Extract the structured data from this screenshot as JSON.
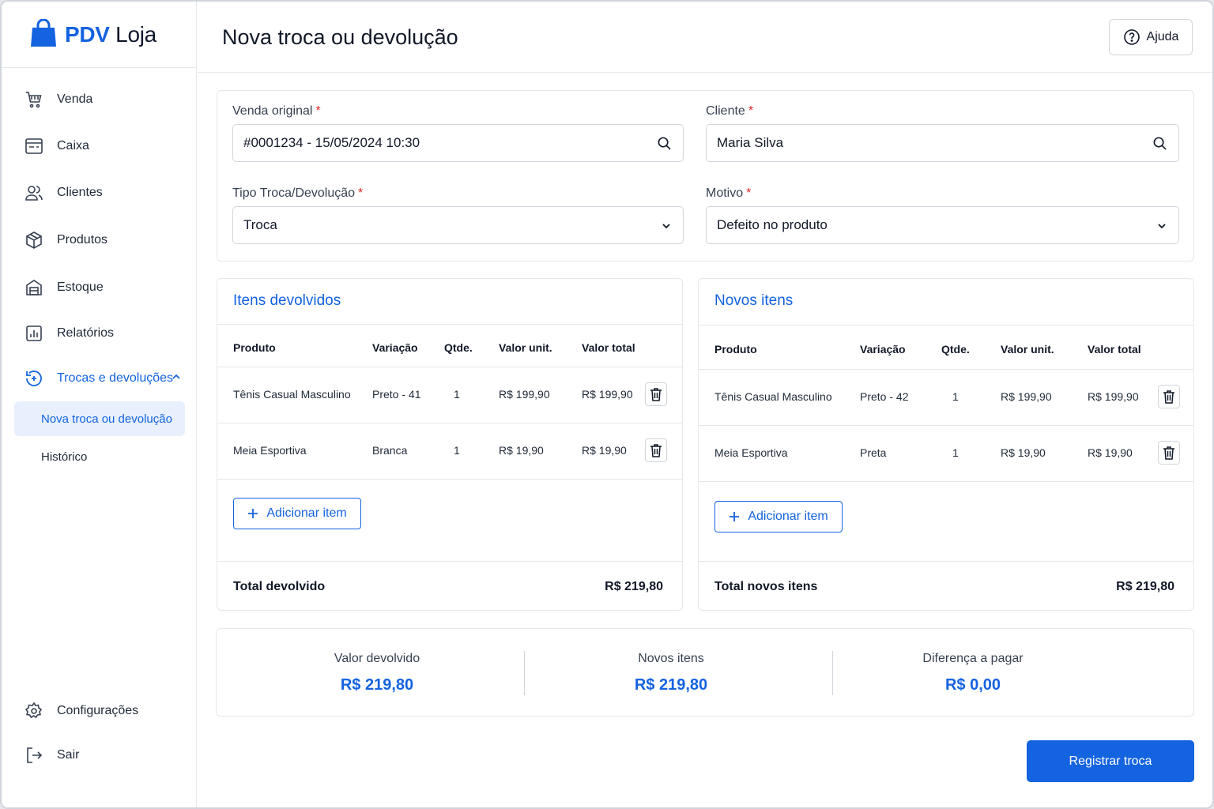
{
  "brand": {
    "pdv": "PDV",
    "loja": "Loja"
  },
  "sidebar": {
    "items": [
      {
        "label": "Venda",
        "icon": "cart-icon"
      },
      {
        "label": "Caixa",
        "icon": "cash-register-icon"
      },
      {
        "label": "Clientes",
        "icon": "users-icon"
      },
      {
        "label": "Produtos",
        "icon": "box-icon"
      },
      {
        "label": "Estoque",
        "icon": "warehouse-icon"
      },
      {
        "label": "Relatórios",
        "icon": "chart-icon"
      },
      {
        "label": "Trocas e devoluções",
        "icon": "exchange-icon"
      }
    ],
    "sub_items": [
      {
        "label": "Nova troca ou devolução",
        "active": true
      },
      {
        "label": "Histórico",
        "active": false
      }
    ],
    "bottom_items": [
      {
        "label": "Configurações",
        "icon": "gear-icon"
      },
      {
        "label": "Sair",
        "icon": "logout-icon"
      }
    ]
  },
  "header": {
    "title": "Nova troca ou devolução",
    "help_label": "Ajuda"
  },
  "form": {
    "venda_original": {
      "label": "Venda original",
      "value": "#0001234 - 15/05/2024 10:30"
    },
    "cliente": {
      "label": "Cliente",
      "value": "Maria Silva"
    },
    "tipo": {
      "label": "Tipo Troca/Devolução",
      "value": "Troca"
    },
    "motivo": {
      "label": "Motivo",
      "value": "Defeito no produto"
    },
    "required_mark": "*"
  },
  "returned": {
    "title": "Itens devolvidos",
    "columns": [
      "Produto",
      "Variação",
      "Qtde.",
      "Valor unit.",
      "Valor total"
    ],
    "rows": [
      {
        "produto": "Tênis Casual Masculino",
        "variacao": "Preto - 41",
        "qtde": "1",
        "valor_unit": "R$ 199,90",
        "valor_total": "R$ 199,90"
      },
      {
        "produto": "Meia Esportiva",
        "variacao": "Branca",
        "qtde": "1",
        "valor_unit": "R$ 19,90",
        "valor_total": "R$ 19,90"
      }
    ],
    "add_label": "Adicionar item",
    "total_label": "Total devolvido",
    "total_value": "R$ 219,80"
  },
  "new_items": {
    "title": "Novos itens",
    "columns": [
      "Produto",
      "Variação",
      "Qtde.",
      "Valor unit.",
      "Valor total"
    ],
    "rows": [
      {
        "produto": "Tênis Casual Masculino",
        "variacao": "Preto - 42",
        "qtde": "1",
        "valor_unit": "R$ 199,90",
        "valor_total": "R$ 199,90"
      },
      {
        "produto": "Meia Esportiva",
        "variacao": "Preta",
        "qtde": "1",
        "valor_unit": "R$ 19,90",
        "valor_total": "R$ 19,90"
      }
    ],
    "add_label": "Adicionar item",
    "total_label": "Total novos itens",
    "total_value": "R$ 219,80"
  },
  "summary": [
    {
      "label": "Valor devolvido",
      "value": "R$ 219,80"
    },
    {
      "label": "Novos itens",
      "value": "R$ 219,80"
    },
    {
      "label": "Diferença a pagar",
      "value": "R$ 0,00"
    }
  ],
  "submit_label": "Registrar troca",
  "colors": {
    "accent": "#1463e0",
    "required": "#dc2626",
    "active_bg": "#e8f0fd"
  }
}
